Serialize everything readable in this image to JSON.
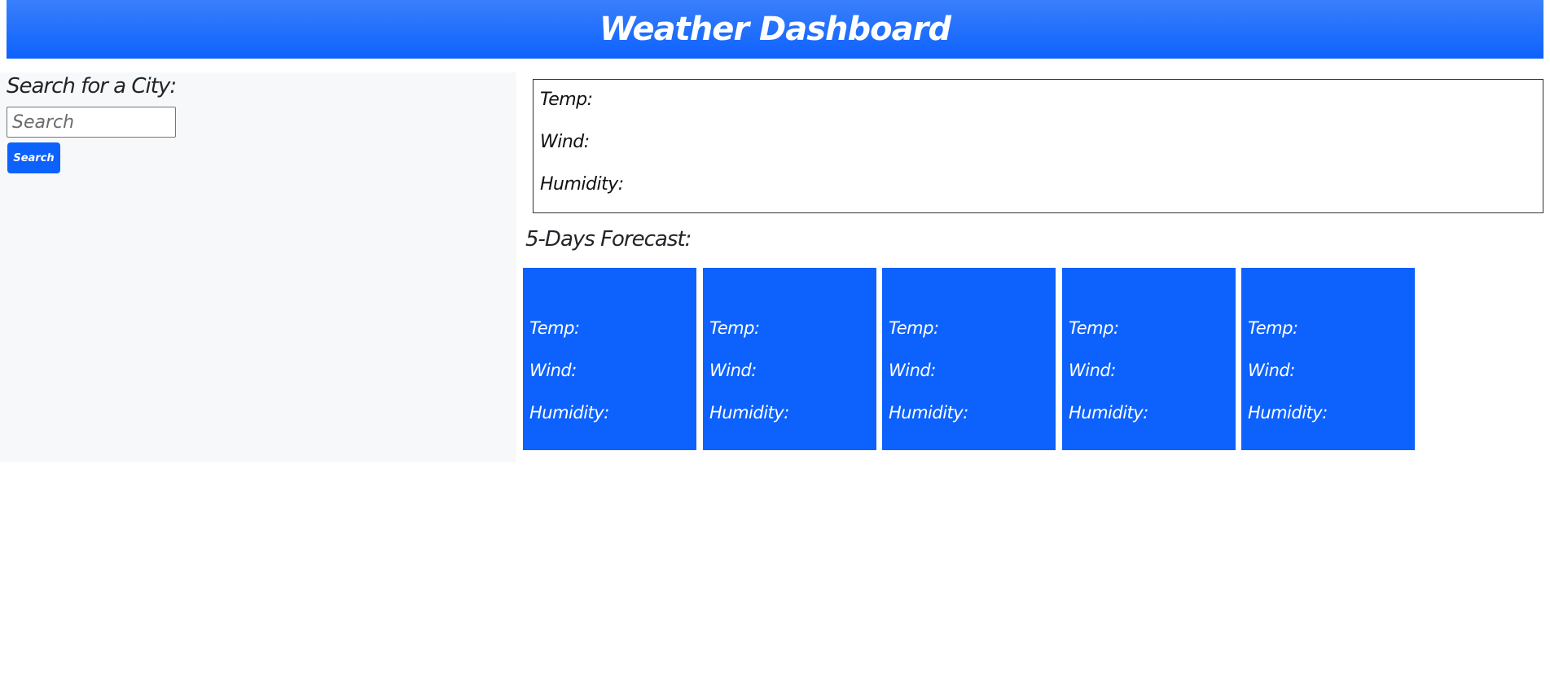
{
  "header": {
    "title": "Weather Dashboard"
  },
  "sidebar": {
    "heading": "Search for a City:",
    "search_placeholder": "Search",
    "search_value": "",
    "search_button_label": "Search"
  },
  "current": {
    "temp_label": "Temp:",
    "wind_label": "Wind:",
    "humidity_label": "Humidity:"
  },
  "forecast": {
    "title": "5-Days Forecast:",
    "cards": [
      {
        "temp_label": "Temp:",
        "wind_label": "Wind:",
        "humidity_label": "Humidity:"
      },
      {
        "temp_label": "Temp:",
        "wind_label": "Wind:",
        "humidity_label": "Humidity:"
      },
      {
        "temp_label": "Temp:",
        "wind_label": "Wind:",
        "humidity_label": "Humidity:"
      },
      {
        "temp_label": "Temp:",
        "wind_label": "Wind:",
        "humidity_label": "Humidity:"
      },
      {
        "temp_label": "Temp:",
        "wind_label": "Wind:",
        "humidity_label": "Humidity:"
      }
    ]
  },
  "colors": {
    "accent": "#0d62fd",
    "sidebar_bg": "#f7f8f9",
    "text": "#212529"
  }
}
